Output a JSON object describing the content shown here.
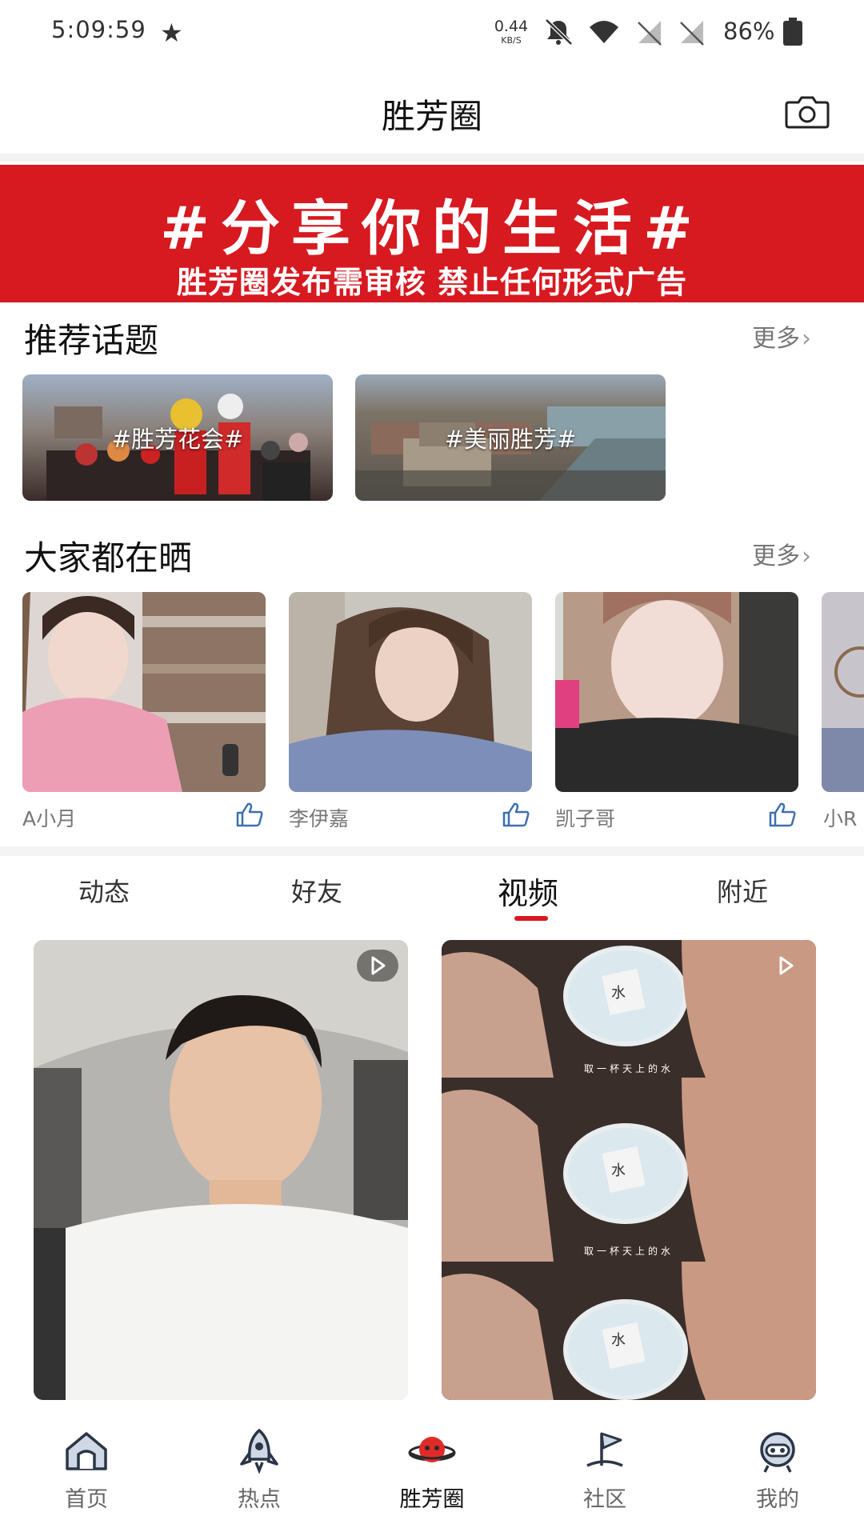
{
  "status_bar": {
    "time": "5:09:59",
    "net_speed_value": "0.44",
    "net_speed_unit": "KB/S",
    "battery": "86%"
  },
  "header": {
    "title": "胜芳圈"
  },
  "banner": {
    "title": "#分享你的生活#",
    "subtitle": "胜芳圈发布需审核 禁止任何形式广告",
    "color": "#d71920"
  },
  "recommended_topics": {
    "title": "推荐话题",
    "more": "更多",
    "items": [
      {
        "label": "#胜芳花会#"
      },
      {
        "label": "#美丽胜芳#"
      }
    ]
  },
  "everyone_sharing": {
    "title": "大家都在晒",
    "more": "更多",
    "items": [
      {
        "name": "A小月"
      },
      {
        "name": "李伊嘉"
      },
      {
        "name": "凯子哥"
      },
      {
        "name": "小R"
      }
    ]
  },
  "tabs": [
    {
      "label": "动态"
    },
    {
      "label": "好友"
    },
    {
      "label": "视频",
      "active": true
    },
    {
      "label": "附近"
    }
  ],
  "videos": [
    {
      "caption": ""
    },
    {
      "captions": [
        "取一杯天上的水",
        "取一杯天上的水"
      ],
      "cup_text": "水"
    }
  ],
  "bottom_nav": [
    {
      "label": "首页",
      "icon": "home-icon"
    },
    {
      "label": "热点",
      "icon": "rocket-icon"
    },
    {
      "label": "胜芳圈",
      "icon": "planet-icon",
      "active": true
    },
    {
      "label": "社区",
      "icon": "flag-icon"
    },
    {
      "label": "我的",
      "icon": "robot-face-icon"
    }
  ],
  "colors": {
    "accent": "#d71920",
    "text_secondary": "#777777"
  }
}
